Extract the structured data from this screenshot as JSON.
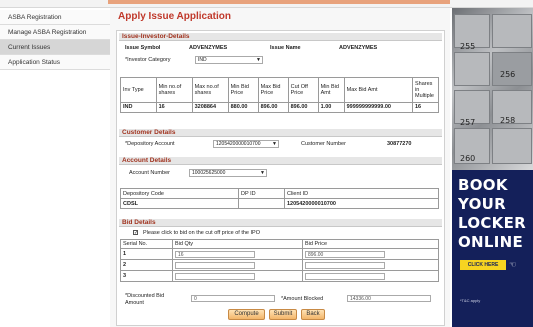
{
  "sidebar": {
    "items": [
      {
        "label": "ASBA Registration"
      },
      {
        "label": "Manage ASBA Registration"
      },
      {
        "label": "Current Issues"
      },
      {
        "label": "Application Status"
      }
    ]
  },
  "page": {
    "title": "Apply Issue Application"
  },
  "issue_investor": {
    "header": "Issue-Investor-Details",
    "issue_symbol_label": "Issue Symbol",
    "issue_symbol_value": "ADVENZYMES",
    "issue_name_label": "Issue Name",
    "issue_name_value": "ADVENZYMES",
    "investor_category_label": "*Investor Category",
    "investor_category_value": "IND",
    "table": {
      "headers": [
        "Inv Type",
        "Min no.of shares",
        "Max no.of shares",
        "Min Bid Price",
        "Max Bid Price",
        "Cut Off Price",
        "Min Bid Amt",
        "Max Bid Amt",
        "Shares in Multiple"
      ],
      "row": [
        "IND",
        "16",
        "3208864",
        "880.00",
        "896.00",
        "896.00",
        "1.00",
        "999999999999.00",
        "16"
      ]
    }
  },
  "customer": {
    "header": "Customer Details",
    "depository_label": "*Depository Account",
    "depository_value": "1205420000010700",
    "customer_number_label": "Customer Number",
    "customer_number_value": "30877270"
  },
  "account": {
    "header": "Account Details",
    "account_number_label": "Account Number",
    "account_number_value": "100025625000",
    "table": {
      "headers": [
        "Depository Code",
        "DP ID",
        "Client ID"
      ],
      "row": [
        "CDSL",
        "",
        "1205420000010700"
      ]
    }
  },
  "bid": {
    "header": "Bid Details",
    "cutoff_label": "Please click to bid on the cut off price of the IPO",
    "cutoff_checked": "✓",
    "table": {
      "headers": [
        "Serial No.",
        "Bid Qty",
        "Bid Price"
      ],
      "rows": [
        {
          "serial": "1",
          "qty": "16",
          "price": "896.00"
        },
        {
          "serial": "2",
          "qty": "",
          "price": ""
        },
        {
          "serial": "3",
          "qty": "",
          "price": ""
        }
      ]
    },
    "discounted_label": "*Discounted Bid Amount",
    "discounted_value": "0",
    "amount_blocked_label": "*Amount Blocked",
    "amount_blocked_value": "14336.00"
  },
  "buttons": {
    "compute": "Compute",
    "submit": "Submit",
    "back": "Back"
  },
  "ad": {
    "line1": "BOOK",
    "line2": "YOUR",
    "line3": "LOCKER",
    "line4": "ONLINE",
    "cta": "CLICK HERE",
    "tc": "*T&C apply",
    "locker_numbers": [
      "255",
      "256",
      "257",
      "258",
      "260"
    ],
    "colors": {
      "bg": "#14205a",
      "cta": "#f6d421"
    }
  },
  "colors": {
    "title": "#c0392b",
    "section": "#a0321e",
    "button": "#f3b66a"
  }
}
